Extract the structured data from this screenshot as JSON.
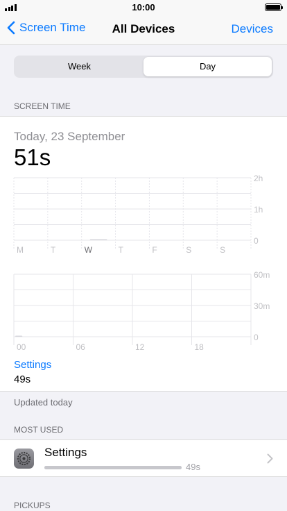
{
  "status_bar": {
    "time": "10:00",
    "battery_level": 1.0
  },
  "nav": {
    "back_label": "Screen Time",
    "title": "All Devices",
    "right_label": "Devices"
  },
  "segments": [
    {
      "label": "Week",
      "selected": false
    },
    {
      "label": "Day",
      "selected": true
    }
  ],
  "screen_time": {
    "section_title": "SCREEN TIME",
    "date": "Today, 23 September",
    "total": "51s",
    "weekly_chart": {
      "y_labels": [
        "2h",
        "1h",
        "0"
      ],
      "x_labels": [
        "M",
        "T",
        "W",
        "T",
        "F",
        "S",
        "S"
      ],
      "highlighted_day": "W"
    },
    "hourly_chart": {
      "y_labels": [
        "60m",
        "30m",
        "0"
      ],
      "x_labels": [
        "00",
        "06",
        "12",
        "18"
      ]
    },
    "top_app": {
      "name": "Settings",
      "time": "49s"
    },
    "updated": "Updated today"
  },
  "chart_data": [
    {
      "type": "bar",
      "categories": [
        "M",
        "T",
        "W",
        "T",
        "F",
        "S",
        "S"
      ],
      "values": [
        0,
        0,
        0.85,
        0,
        0,
        0,
        0
      ],
      "ylabel": "",
      "ylim": [
        0,
        120
      ],
      "y_ticks": [
        "2h",
        "1h",
        "0"
      ]
    },
    {
      "type": "bar",
      "categories": [
        "00",
        "06",
        "12",
        "18"
      ],
      "x_hours": 24,
      "values_by_hour": [
        {
          "hour": 0,
          "minutes": 0.85
        }
      ],
      "ylim": [
        0,
        60
      ],
      "y_ticks": [
        "60m",
        "30m",
        "0"
      ]
    }
  ],
  "most_used": {
    "section_title": "MOST USED",
    "items": [
      {
        "name": "Settings",
        "time": "49s",
        "icon": "settings-gear-icon",
        "usage_fraction": 1.0
      }
    ]
  },
  "pickups": {
    "section_title": "PICKUPS"
  },
  "colors": {
    "accent": "#0a7aff",
    "grid": "#e5e5ea",
    "axis_text": "#c0c0c4"
  }
}
